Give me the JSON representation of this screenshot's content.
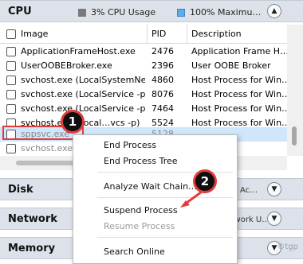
{
  "cpu": {
    "title": "CPU",
    "usage": "3% CPU Usage",
    "max": "100% Maximu…",
    "columns": {
      "image": "Image",
      "pid": "PID",
      "description": "Description"
    },
    "rows": [
      {
        "image": "ApplicationFrameHost.exe",
        "pid": "2476",
        "description": "Application Frame H…"
      },
      {
        "image": "UserOOBEBroker.exe",
        "pid": "2396",
        "description": "User OOBE Broker"
      },
      {
        "image": "svchost.exe (LocalSystemNet…",
        "pid": "4860",
        "description": "Host Process for Win…"
      },
      {
        "image": "svchost.exe (LocalService -p)",
        "pid": "8076",
        "description": "Host Process for Win…"
      },
      {
        "image": "svchost.exe (LocalService -p)",
        "pid": "7464",
        "description": "Host Process for Win…"
      },
      {
        "image": "svchost.exe (Local…vcs -p)",
        "pid": "5524",
        "description": "Host Process for Win…"
      },
      {
        "image": "sppsvc.exe",
        "pid": "5128",
        "description": ""
      },
      {
        "image": "svchost.exe (…",
        "pid": "",
        "description": ""
      }
    ]
  },
  "sections": {
    "disk": {
      "title": "Disk",
      "extra": "Ac…"
    },
    "network": {
      "title": "Network",
      "extra": "Network U…"
    },
    "memory": {
      "title": "Memory",
      "extra": ""
    }
  },
  "menu": {
    "end_process": "End Process",
    "end_process_tree": "End Process Tree",
    "analyze": "Analyze Wait Chain…",
    "suspend": "Suspend Process",
    "resume": "Resume Process",
    "search": "Search Online"
  },
  "annotations": {
    "step1": "1",
    "step2": "2",
    "highlight_color": "#e23c3c"
  },
  "watermark": "©tgp"
}
